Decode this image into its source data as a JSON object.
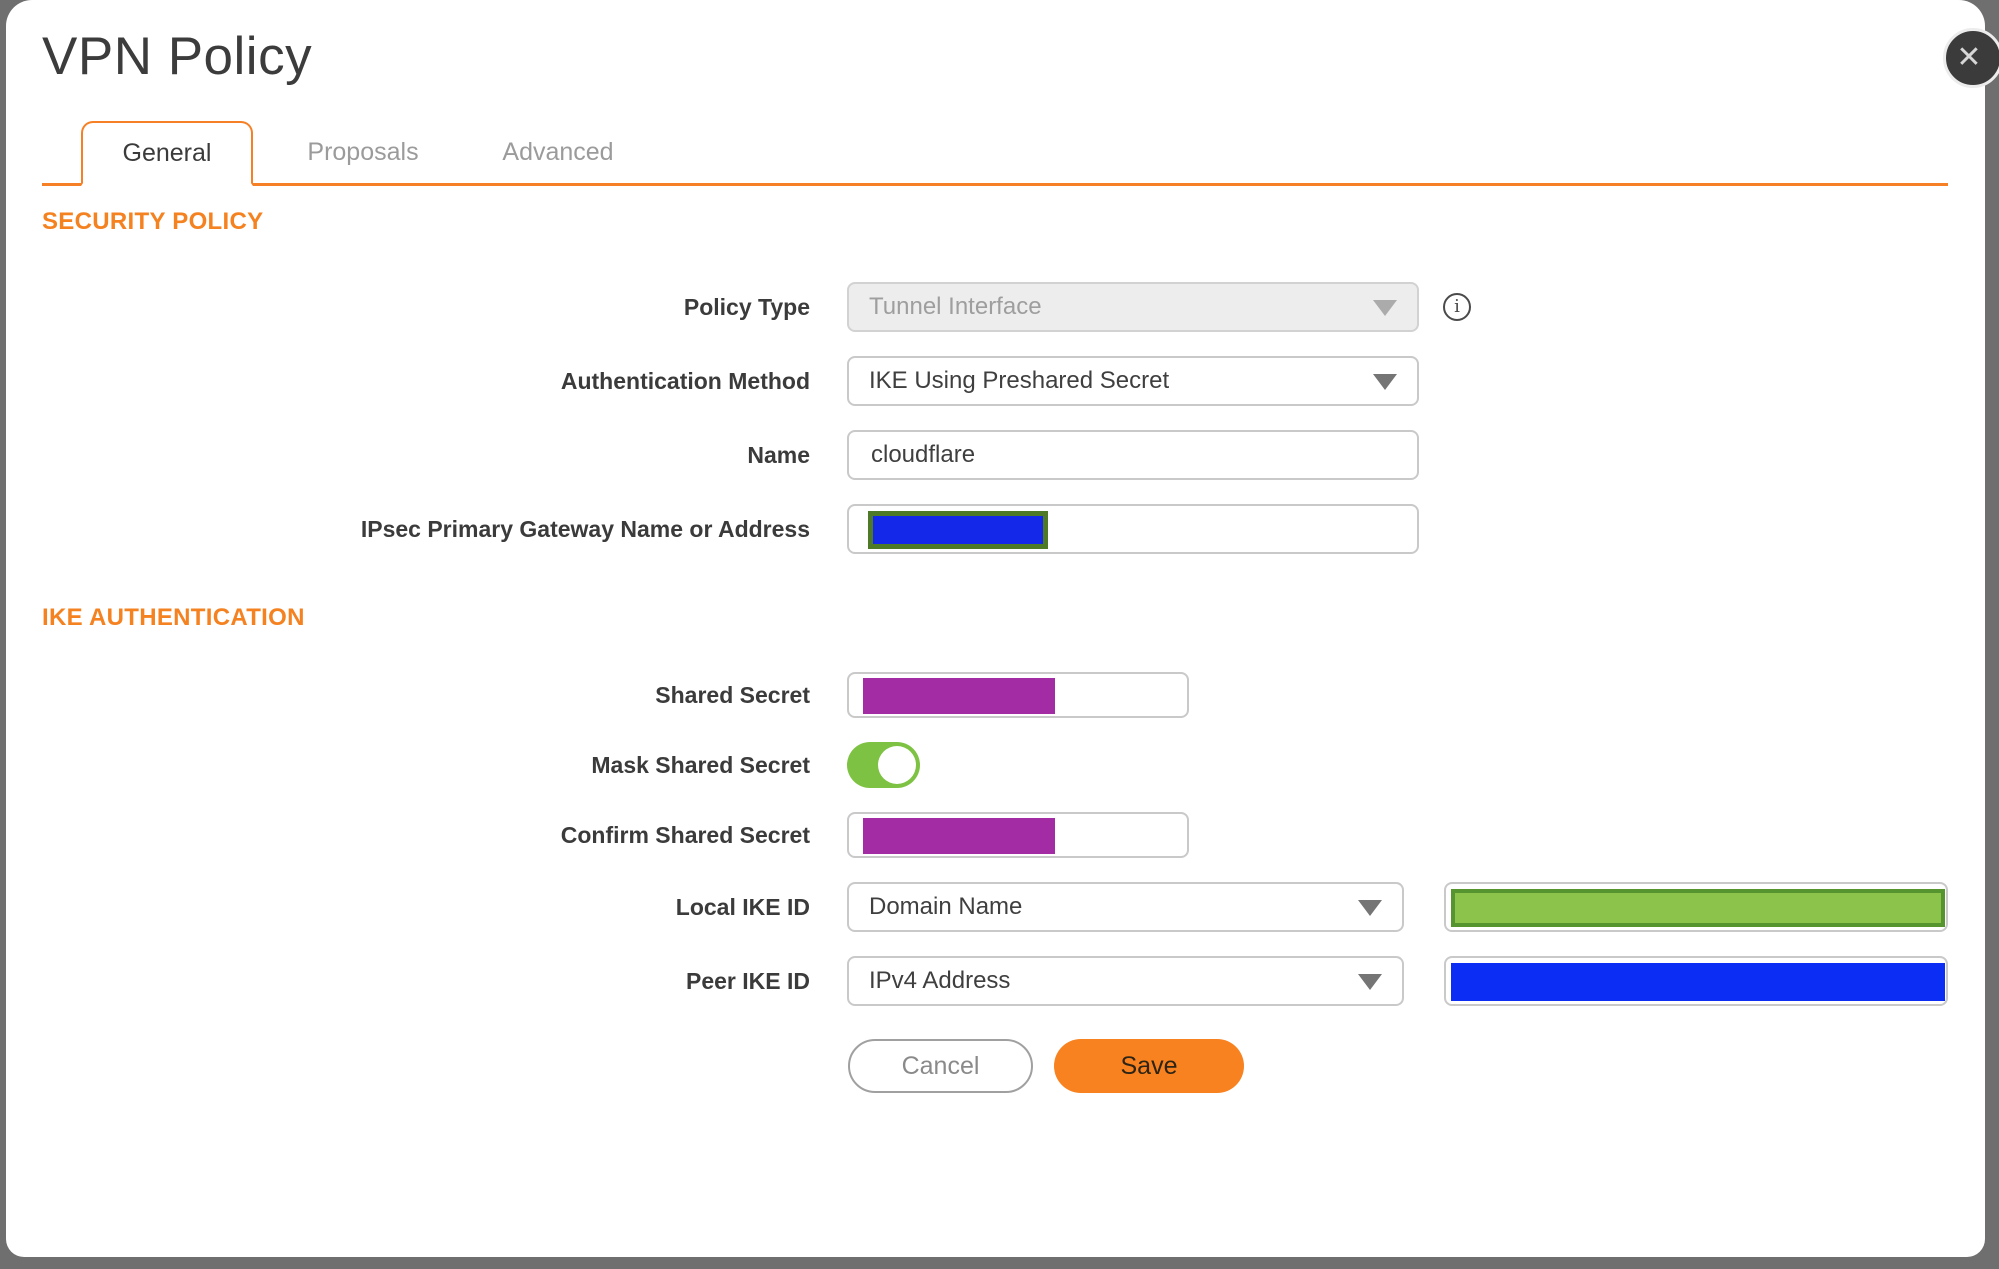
{
  "dialog": {
    "title": "VPN Policy"
  },
  "icons": {
    "close": "✕",
    "info": "i"
  },
  "tabs": [
    {
      "label": "General",
      "active": true
    },
    {
      "label": "Proposals",
      "active": false
    },
    {
      "label": "Advanced",
      "active": false
    }
  ],
  "sections": {
    "security_policy": "SECURITY POLICY",
    "ike_authentication": "IKE AUTHENTICATION"
  },
  "fields": {
    "policy_type": {
      "label": "Policy Type",
      "value": "Tunnel Interface",
      "disabled": true
    },
    "auth_method": {
      "label": "Authentication Method",
      "value": "IKE Using Preshared Secret"
    },
    "name": {
      "label": "Name",
      "value": "cloudflare"
    },
    "gateway": {
      "label": "IPsec Primary Gateway Name or Address",
      "redacted": true
    },
    "shared_secret": {
      "label": "Shared Secret",
      "redacted": true
    },
    "mask_shared_secret": {
      "label": "Mask Shared Secret",
      "state": "on"
    },
    "confirm_shared_secret": {
      "label": "Confirm Shared Secret",
      "redacted": true
    },
    "local_ike_id": {
      "label": "Local IKE ID",
      "value": "Domain Name",
      "redacted_value_field": true
    },
    "peer_ike_id": {
      "label": "Peer IKE ID",
      "value": "IPv4 Address",
      "redacted_value_field": true
    }
  },
  "buttons": {
    "cancel": "Cancel",
    "save": "Save"
  },
  "colors": {
    "accent_orange": "#F58025",
    "save_orange": "#F8821F",
    "toggle_green": "#7DC242",
    "redact_purple": "#A32CA5",
    "redact_blue": "#0C2DF4",
    "redact_green_fill": "#8CC34B",
    "redact_green_border": "#55942E",
    "redact_olive_border": "#4E7A28",
    "backdrop_gray": "#6F6F6F"
  }
}
